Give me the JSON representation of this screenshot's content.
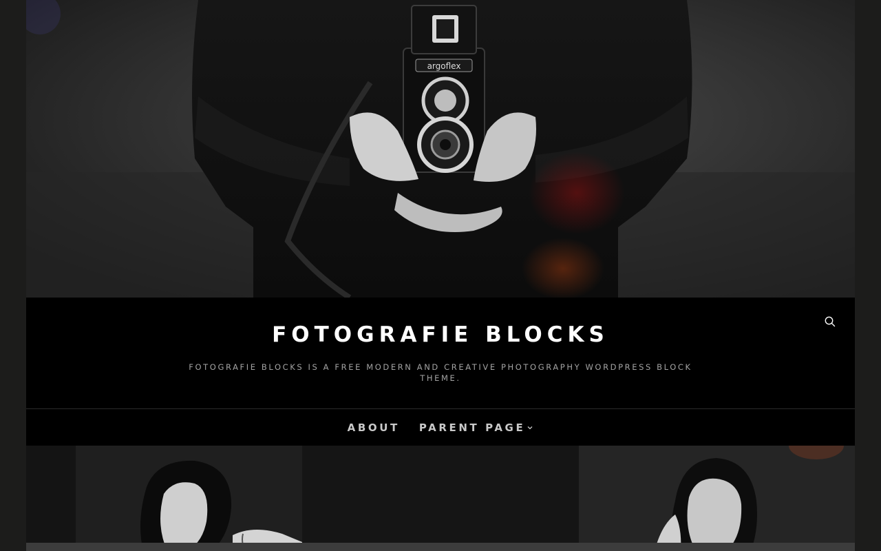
{
  "site": {
    "title": "FOTOGRAFIE BLOCKS",
    "description": "FOTOGRAFIE BLOCKS IS A FREE MODERN AND CREATIVE PHOTOGRAPHY WORDPRESS BLOCK THEME."
  },
  "header": {
    "search_icon": "search-icon"
  },
  "nav": {
    "items": [
      {
        "label": "ABOUT"
      },
      {
        "label": "PARENT PAGE",
        "icon": "chevron-down-icon"
      }
    ]
  },
  "colors": {
    "background": "#000000",
    "page_bg": "#1c1c1b",
    "title": "#ffffff",
    "description": "#a3a3a3",
    "nav_text": "#c9c9c9"
  }
}
